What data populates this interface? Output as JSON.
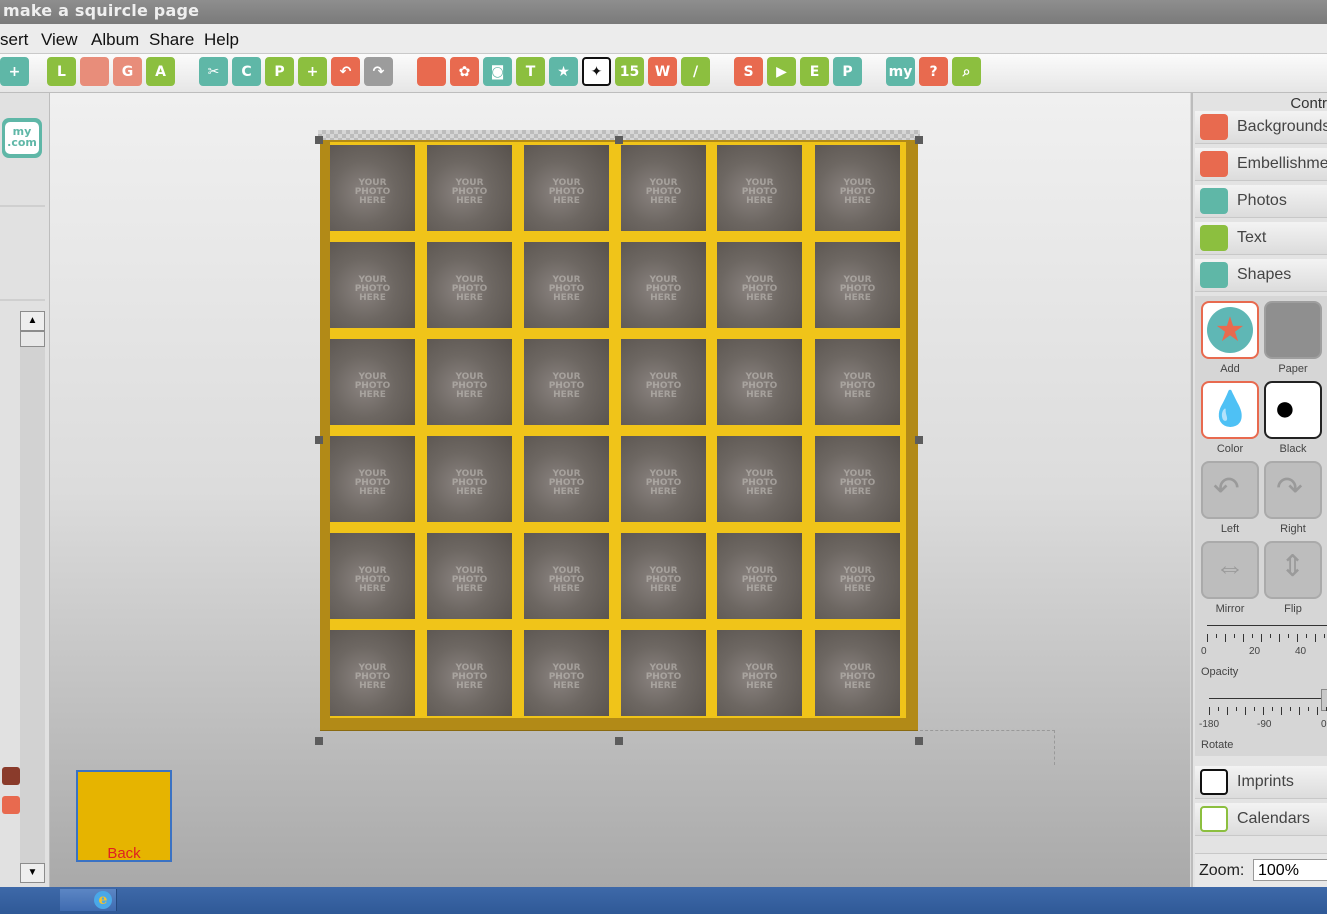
{
  "window": {
    "title": "make a squircle page"
  },
  "menu": [
    "sert",
    "View",
    "Album",
    "Share",
    "Help"
  ],
  "toolbar": {
    "icons": [
      {
        "name": "add-page-icon",
        "glyph": "+",
        "color": "#5fb7a7"
      },
      {
        "name": "layout-icon",
        "glyph": "L",
        "color": "#8cbf3f"
      },
      {
        "name": "ruler-icon",
        "glyph": "",
        "color": "#e88d7a"
      },
      {
        "name": "guides-icon",
        "glyph": "G",
        "color": "#e88d7a"
      },
      {
        "name": "align-icon",
        "glyph": "A",
        "color": "#8cbf3f"
      },
      {
        "name": "cut-icon",
        "glyph": "✂",
        "color": "#5fb7a7"
      },
      {
        "name": "copy-icon",
        "glyph": "C",
        "color": "#5fb7a7"
      },
      {
        "name": "paste-icon",
        "glyph": "P",
        "color": "#8cbf3f"
      },
      {
        "name": "duplicate-icon",
        "glyph": "+",
        "color": "#8cbf3f"
      },
      {
        "name": "undo-icon",
        "glyph": "↶",
        "color": "#e86a4f"
      },
      {
        "name": "redo-icon",
        "glyph": "↷",
        "color": "#9c9c9c"
      },
      {
        "name": "backgrounds-icon",
        "glyph": "",
        "color": "#e86a4f"
      },
      {
        "name": "embellishments-icon",
        "glyph": "✿",
        "color": "#e86a4f"
      },
      {
        "name": "photos-icon",
        "glyph": "◙",
        "color": "#5fb7a7"
      },
      {
        "name": "text-icon",
        "glyph": "T",
        "color": "#8cbf3f"
      },
      {
        "name": "shapes-icon",
        "glyph": "★",
        "color": "#5fb7a7"
      },
      {
        "name": "imprints-icon",
        "glyph": "✦",
        "color": "#111111"
      },
      {
        "name": "calendar-icon",
        "glyph": "15",
        "color": "#8cbf3f"
      },
      {
        "name": "wordart-icon",
        "glyph": "W",
        "color": "#e86a4f"
      },
      {
        "name": "brush-icon",
        "glyph": "/",
        "color": "#8cbf3f"
      },
      {
        "name": "spellcheck-icon",
        "glyph": "S",
        "color": "#e86a4f"
      },
      {
        "name": "slideshow-icon",
        "glyph": "▶",
        "color": "#8cbf3f"
      },
      {
        "name": "export-icon",
        "glyph": "E",
        "color": "#8cbf3f"
      },
      {
        "name": "print-icon",
        "glyph": "P",
        "color": "#5fb7a7"
      },
      {
        "name": "mycom-icon",
        "glyph": "my",
        "color": "#5fb7a7"
      },
      {
        "name": "help-icon",
        "glyph": "?",
        "color": "#e86a4f"
      },
      {
        "name": "zoom-icon",
        "glyph": "⌕",
        "color": "#8cbf3f"
      }
    ]
  },
  "left": {
    "mycom_glyph": "my\n.com",
    "thumb_label": "Back"
  },
  "canvas": {
    "photo_text_1": "YOUR",
    "photo_text_2": "PHOTO",
    "photo_text_3": "HERE",
    "rows": 6,
    "cols": 6
  },
  "right": {
    "header": "Contr",
    "categories": [
      {
        "label": "Backgrounds",
        "icon": "backgrounds-icon",
        "color": "#e86a4f"
      },
      {
        "label": "Embellishmer",
        "icon": "embellishments-icon",
        "color": "#e86a4f"
      },
      {
        "label": "Photos",
        "icon": "photos-icon",
        "color": "#5fb7a7"
      },
      {
        "label": "Text",
        "icon": "text-icon",
        "color": "#8cbf3f"
      },
      {
        "label": "Shapes",
        "icon": "shapes-icon",
        "color": "#5fb7a7"
      }
    ],
    "tools": [
      {
        "label": "Add",
        "icon": "add-star-icon"
      },
      {
        "label": "Paper",
        "icon": "paper-icon"
      },
      {
        "label": "Color",
        "icon": "color-drops-icon"
      },
      {
        "label": "Black",
        "icon": "black-drops-icon"
      },
      {
        "label": "Left",
        "icon": "rotate-left-icon"
      },
      {
        "label": "Right",
        "icon": "rotate-right-icon"
      },
      {
        "label": "Mirror",
        "icon": "mirror-icon"
      },
      {
        "label": "Flip",
        "icon": "flip-icon"
      }
    ],
    "opacity": {
      "label": "Opacity",
      "ticks": [
        "0",
        "20",
        "40"
      ]
    },
    "rotate": {
      "label": "Rotate",
      "ticks": [
        "-180",
        "-90",
        "0"
      ]
    },
    "bottom_categories": [
      {
        "label": "Imprints",
        "icon": "imprints-icon",
        "color": "#111111"
      },
      {
        "label": "Calendars",
        "icon": "calendar-icon",
        "color": "#8cbf3f"
      }
    ],
    "zoom": {
      "label": "Zoom:",
      "value": "100%"
    }
  }
}
